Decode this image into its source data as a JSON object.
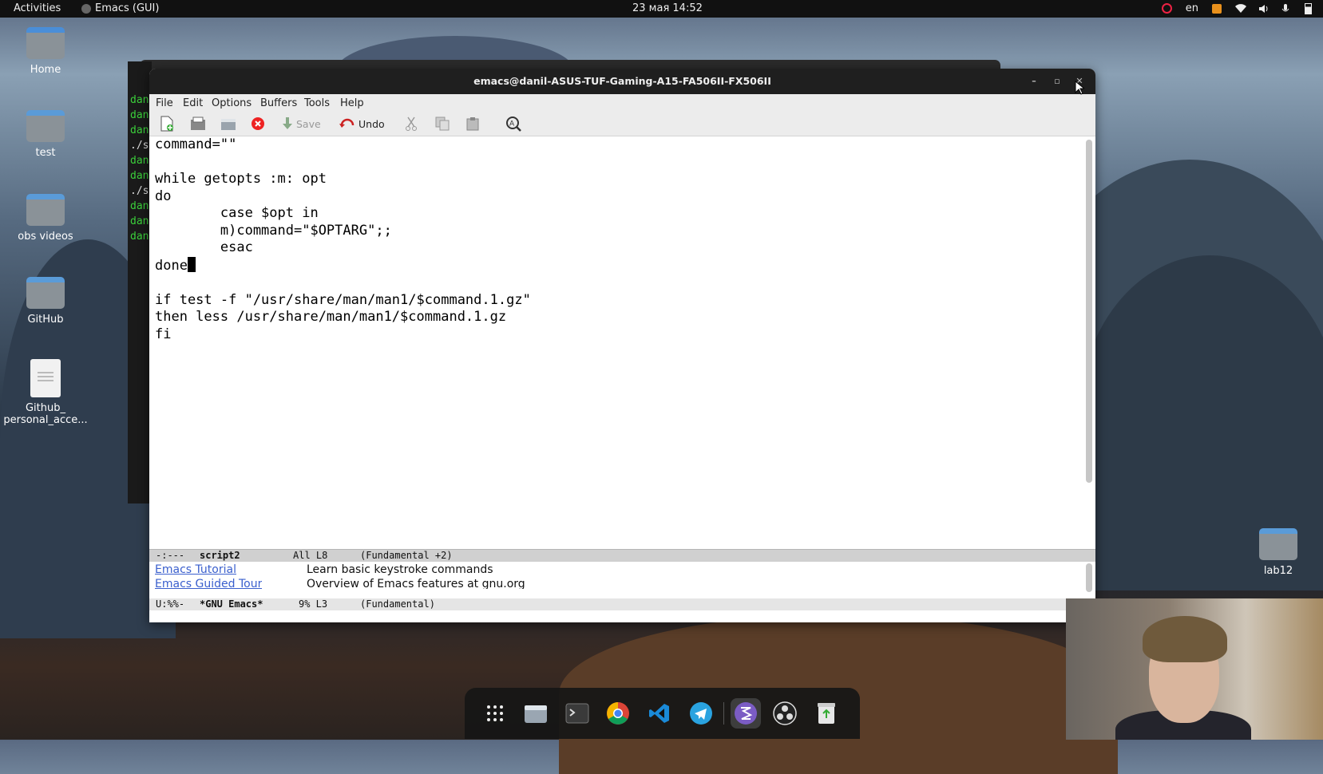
{
  "topbar": {
    "activities": "Activities",
    "app_name": "Emacs (GUI)",
    "clock": "23 мая  14:52",
    "lang": "en"
  },
  "desktop": {
    "icons": [
      {
        "label": "Home",
        "type": "home-folder"
      },
      {
        "label": "test",
        "type": "folder"
      },
      {
        "label": "obs videos",
        "type": "folder"
      },
      {
        "label": "GitHub",
        "type": "folder"
      },
      {
        "label": "Github_ personal_acce...",
        "type": "file"
      },
      {
        "label": "lab12",
        "type": "folder"
      }
    ]
  },
  "terminal": {
    "lines": [
      "dan",
      "dan",
      "dan",
      "./s",
      "dan",
      "dan",
      "./s",
      "dan",
      "dan",
      "dan"
    ]
  },
  "emacs": {
    "title": "emacs@danil-ASUS-TUF-Gaming-A15-FA506II-FX506II",
    "menu": [
      "File",
      "Edit",
      "Options",
      "Buffers",
      "Tools",
      "Help"
    ],
    "toolbar": {
      "save": "Save",
      "undo": "Undo"
    },
    "code_lines": [
      "command=\"\"",
      "",
      "while getopts :m: opt",
      "do",
      "        case $opt in",
      "        m)command=\"$OPTARG\";;",
      "        esac",
      "done",
      "",
      "if test -f \"/usr/share/man/man1/$command.1.gz\"",
      "then less /usr/share/man/man1/$command.1.gz",
      "fi"
    ],
    "modeline1": {
      "status": "-:---",
      "buffer": "script2",
      "position": "All L8",
      "mode": "(Fundamental +2)"
    },
    "lower_links": [
      {
        "link": "Emacs Tutorial",
        "desc": "Learn basic keystroke commands"
      },
      {
        "link": "Emacs Guided Tour",
        "desc": "Overview of Emacs features at gnu.org"
      }
    ],
    "modeline2": {
      "status": "U:%%-",
      "buffer": "*GNU Emacs*",
      "position": "9% L3",
      "mode": "(Fundamental)"
    }
  },
  "dock": {
    "items": [
      "apps-grid-icon",
      "files-icon",
      "terminal-icon",
      "chrome-icon",
      "vscode-icon",
      "telegram-icon",
      "emacs-icon",
      "obs-icon",
      "trash-icon"
    ]
  },
  "colors": {
    "accent_link": "#3a5fcd",
    "terminal_green": "#3bd13b",
    "topbar": "#111111"
  }
}
